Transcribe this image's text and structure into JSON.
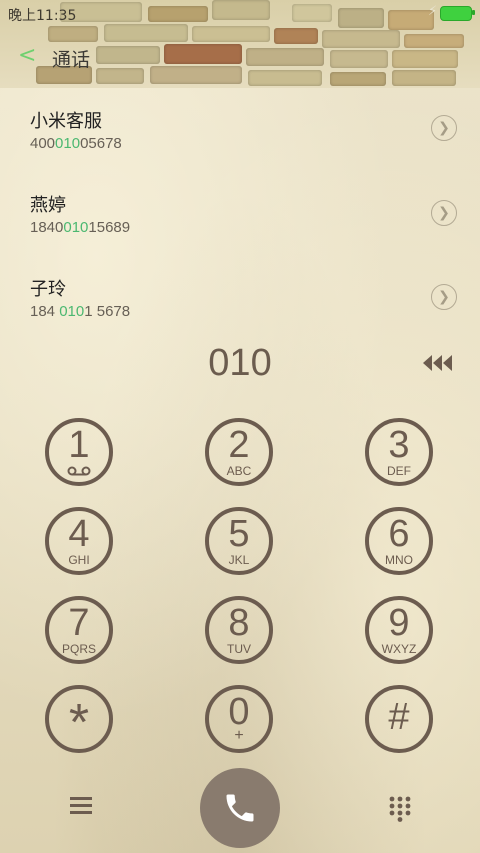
{
  "status": {
    "time": "晚上11:35"
  },
  "nav": {
    "back_glyph": "<",
    "title": "通话"
  },
  "contacts": [
    {
      "name": "小米客服",
      "num_pre": "400",
      "num_hl": "010",
      "num_post": "05678"
    },
    {
      "name": "燕婷",
      "num_pre": "1840",
      "num_hl": "010",
      "num_post": "15689"
    },
    {
      "name": "子玲",
      "num_pre": "184 ",
      "num_hl": "010",
      "num_post": "1 5678"
    }
  ],
  "dialer": {
    "typed": "010",
    "keys": [
      {
        "digit": "1",
        "letters": ""
      },
      {
        "digit": "2",
        "letters": "ABC"
      },
      {
        "digit": "3",
        "letters": "DEF"
      },
      {
        "digit": "4",
        "letters": "GHI"
      },
      {
        "digit": "5",
        "letters": "JKL"
      },
      {
        "digit": "6",
        "letters": "MNO"
      },
      {
        "digit": "7",
        "letters": "PQRS"
      },
      {
        "digit": "8",
        "letters": "TUV"
      },
      {
        "digit": "9",
        "letters": "WXYZ"
      },
      {
        "digit": "*",
        "letters": ""
      },
      {
        "digit": "0",
        "letters": "+"
      },
      {
        "digit": "#",
        "letters": ""
      }
    ]
  },
  "colors": {
    "accent": "#4bb870",
    "key": "#6c5c4f",
    "call_button": "#897b6e"
  },
  "icons": {
    "delete": "backspace-icon",
    "menu": "menu-icon",
    "call": "phone-icon",
    "dialpad": "dialpad-icon",
    "voicemail": "voicemail-icon"
  }
}
